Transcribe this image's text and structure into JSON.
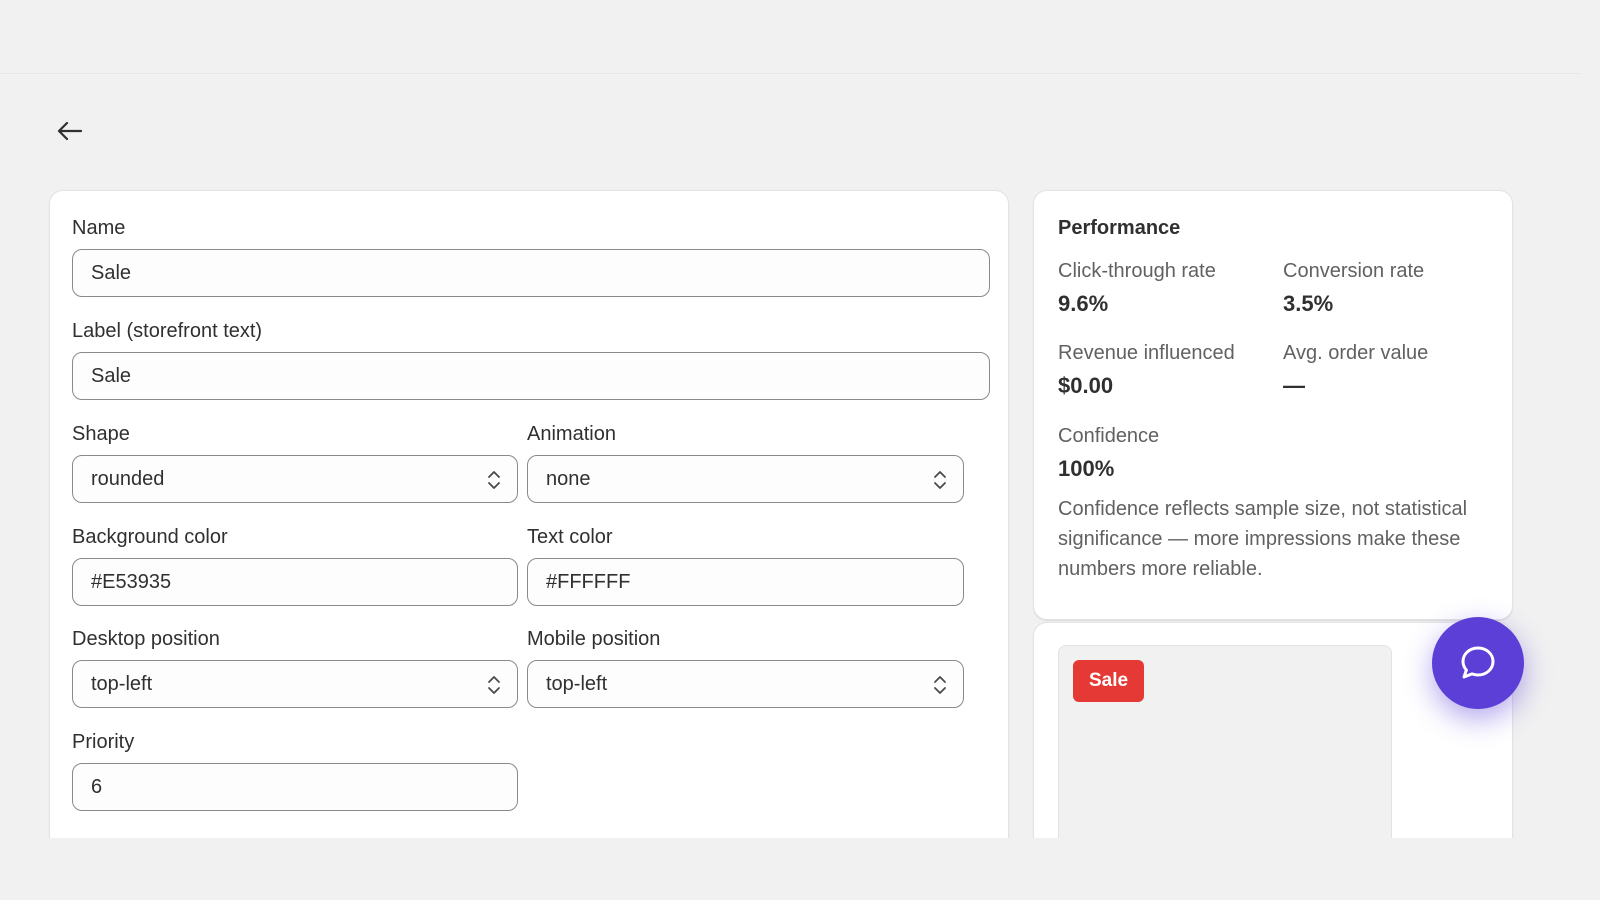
{
  "form": {
    "name": {
      "label": "Name",
      "value": "Sale"
    },
    "label_text": {
      "label": "Label (storefront text)",
      "value": "Sale"
    },
    "shape": {
      "label": "Shape",
      "value": "rounded"
    },
    "animation": {
      "label": "Animation",
      "value": "none"
    },
    "background_color": {
      "label": "Background color",
      "value": "#E53935"
    },
    "text_color": {
      "label": "Text color",
      "value": "#FFFFFF"
    },
    "desktop_position": {
      "label": "Desktop position",
      "value": "top-left"
    },
    "mobile_position": {
      "label": "Mobile position",
      "value": "top-left"
    },
    "priority": {
      "label": "Priority",
      "value": "6"
    }
  },
  "performance": {
    "title": "Performance",
    "click_through": {
      "label": "Click-through rate",
      "value": "9.6%"
    },
    "conversion": {
      "label": "Conversion rate",
      "value": "3.5%"
    },
    "revenue": {
      "label": "Revenue influenced",
      "value": "$0.00"
    },
    "aov": {
      "label": "Avg. order value",
      "value": "—"
    },
    "confidence": {
      "label": "Confidence",
      "value": "100%"
    },
    "note": "Confidence reflects sample size, not statistical significance — more impressions make these numbers more reliable."
  },
  "preview": {
    "badge_text": "Sale",
    "badge_bg": "#E53935",
    "badge_fg": "#FFFFFF"
  },
  "icons": {
    "back": "arrow-left-icon",
    "select": "chevron-up-down-icon",
    "chat": "chat-bubble-icon"
  },
  "colors": {
    "accent": "#5b3fd6",
    "page_bg": "#f1f1f1"
  }
}
